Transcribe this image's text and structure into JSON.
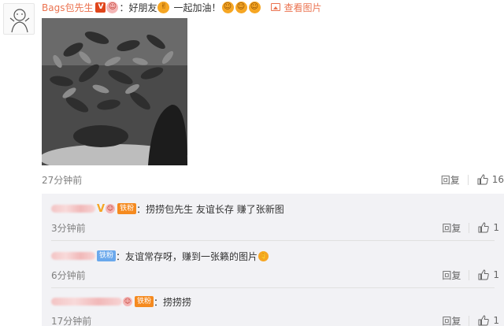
{
  "comment": {
    "username": "Bags包先生",
    "verified_badge": "V",
    "text_a": "：好朋友",
    "text_b": "一起加油！",
    "view_image_link": "查看图片",
    "time": "27分钟前",
    "reply_label": "回复",
    "like_count": "16"
  },
  "replies": [
    {
      "fan_badge": "铁粉",
      "text": "：捞捞包先生 友谊长存 赚了张新图",
      "time": "3分钟前",
      "reply_label": "回复",
      "like_count": "1"
    },
    {
      "fan_badge": "铁粉",
      "text": "：友谊常存呀，赚到一张籁的图片",
      "time": "6分钟前",
      "reply_label": "回复",
      "like_count": "1"
    },
    {
      "fan_badge": "铁粉",
      "text": "：捞捞捞",
      "time": "17分钟前",
      "reply_label": "回复",
      "like_count": "1"
    }
  ],
  "colors": {
    "accent": "#eb7350",
    "fan_orange": "#f58a1f",
    "fan_blue": "#6aa8ec",
    "sub_bg": "#f2f2f5"
  },
  "icons": [
    "avatar-sketch",
    "verified-v-badge",
    "emoji-face",
    "emoji-victory-hand",
    "picture-icon",
    "thumbs-up-icon"
  ]
}
